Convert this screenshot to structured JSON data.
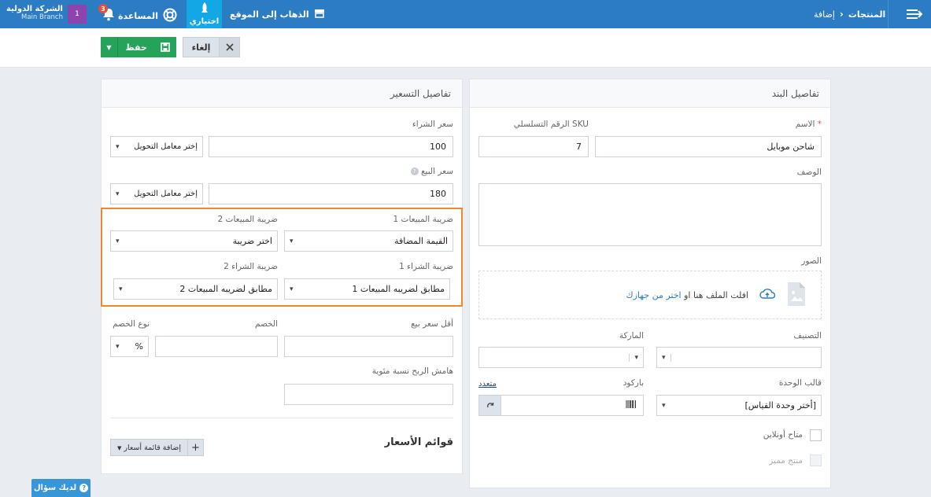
{
  "topbar": {
    "breadcrumb_root": "المنتجات",
    "breadcrumb_current": "إضافة",
    "go_to_site": "الذهاب إلى الموقع",
    "shortcuts": "اختياري",
    "help": "المساعدة",
    "notif_count": "3",
    "company_box": "1",
    "company_name": "الشركة الدولية",
    "branch": "Main Branch"
  },
  "actions": {
    "save": "حفظ",
    "cancel": "إلغاء"
  },
  "item_panel": {
    "title": "تفاصيل البند",
    "name_label": "الاسم",
    "required_mark": "*",
    "name_value": "شاحن موبايل",
    "sku_label": "الرقم التسلسلي SKU",
    "sku_value": "7",
    "desc_label": "الوصف",
    "images_label": "الصور",
    "upload_text": "افلت الملف هنا او",
    "upload_link": "اختر من جهازك",
    "category_label": "التصنيف",
    "brand_label": "الماركة",
    "unit_template_label": "قالب الوحدة",
    "unit_template_value": "[أختر وحدة القياس]",
    "barcode_label": "باركود",
    "barcode_multi": "متعدد",
    "online_label": "متاح أونلاين",
    "featured_label": "منتج مميز"
  },
  "pricing_panel": {
    "title": "تفاصيل التسعير",
    "purchase_price_label": "سعر الشراء",
    "purchase_price_value": "100",
    "conversion_placeholder": "إختر معامل التحويل",
    "sale_price_label": "سعر البيع",
    "sale_price_value": "180",
    "sales_tax1_label": "ضريبة المبيعات 1",
    "sales_tax1_value": "القيمة المضافة",
    "sales_tax2_label": "ضريبة المبيعات 2",
    "sales_tax2_value": "اختر ضريبة",
    "purchase_tax1_label": "ضريبة الشراء 1",
    "purchase_tax1_value": "مطابق لضريبه المبيعات 1",
    "purchase_tax2_label": "ضريبة الشراء 2",
    "purchase_tax2_value": "مطابق لضريبه المبيعات 2",
    "min_price_label": "أقل سعر بيع",
    "discount_label": "الخصم",
    "discount_type_label": "نوع الخصم",
    "discount_type_value": "%",
    "margin_label": "هامش الربح نسبة مئوية",
    "price_lists_title": "قوائم الأسعار",
    "add_price_list": "إضافة قائمة أسعار"
  },
  "help_button": "لديك سؤال"
}
